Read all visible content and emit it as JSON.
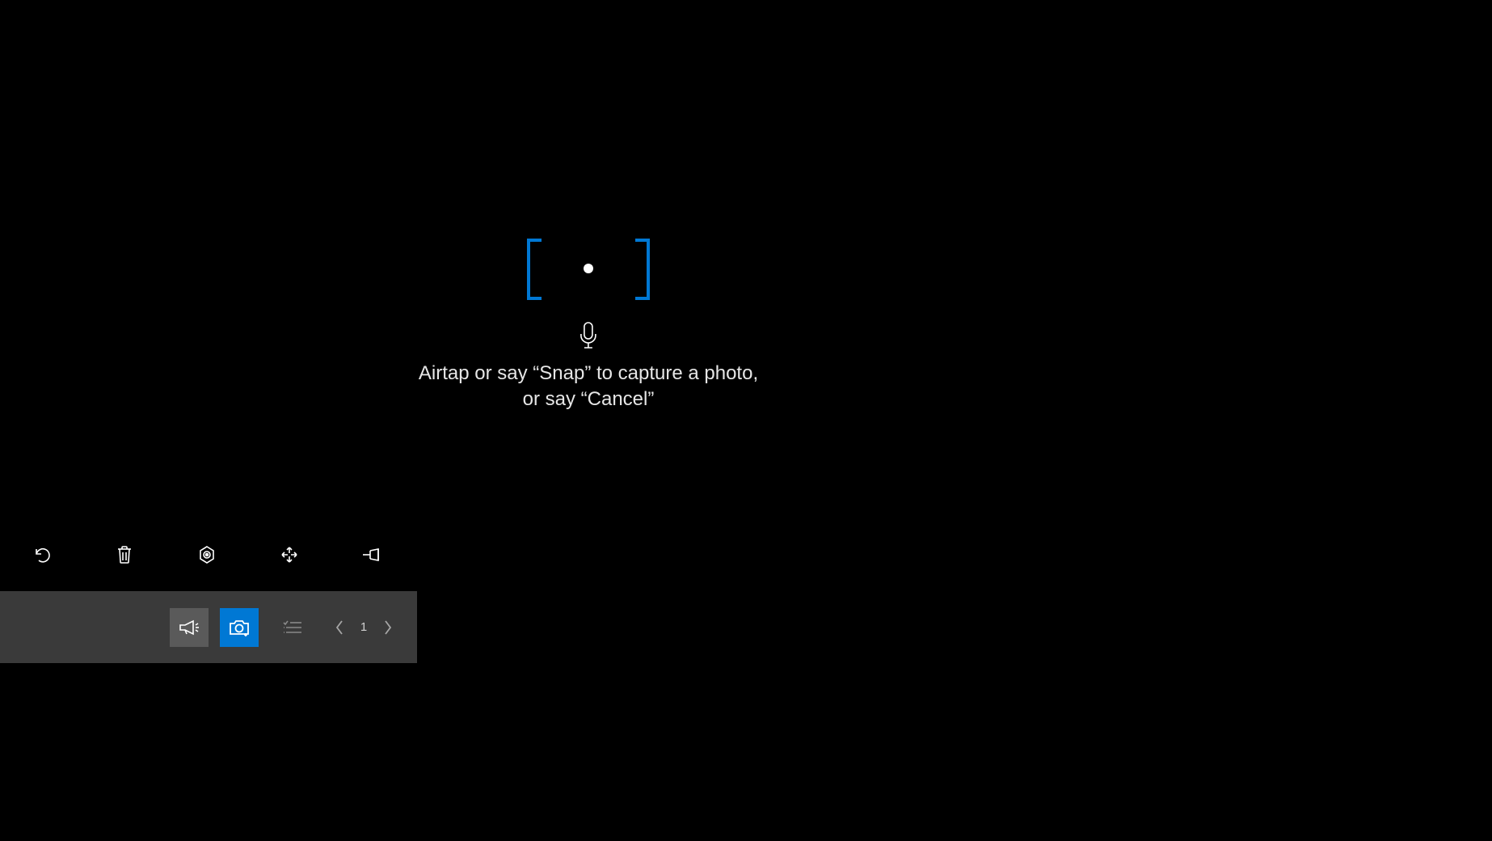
{
  "capture": {
    "instruction": "Airtap or say “Snap” to capture a photo,\nor say “Cancel”"
  },
  "floating_toolbar": {
    "items": [
      {
        "name": "undo-icon"
      },
      {
        "name": "delete-icon"
      },
      {
        "name": "anchor-icon"
      },
      {
        "name": "move-icon"
      },
      {
        "name": "pin-icon"
      }
    ]
  },
  "bottom_bar": {
    "announce_label": "",
    "camera_label": "",
    "page_number": "1"
  },
  "colors": {
    "accent": "#0078d4",
    "bar_bg": "#3a3a3a"
  }
}
